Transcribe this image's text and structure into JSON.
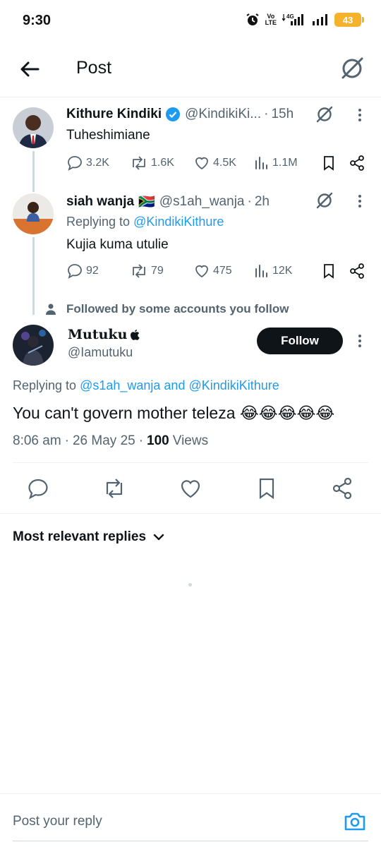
{
  "status_bar": {
    "time": "9:30",
    "battery": "43",
    "network": "4G",
    "volte_top": "Vo",
    "volte_bottom": "LTE"
  },
  "header": {
    "title": "Post"
  },
  "thread": [
    {
      "name": "Kithure Kindiki",
      "verified": true,
      "handle": "@KindikiKi...",
      "time": "15h",
      "text": "Tuheshimiane",
      "stats": {
        "replies": "3.2K",
        "reposts": "1.6K",
        "likes": "4.5K",
        "views": "1.1M"
      }
    },
    {
      "name": "siah wanja",
      "flag": "🇿🇦",
      "handle": "@s1ah_wanja",
      "time": "2h",
      "replying_prefix": "Replying to",
      "replying_to": "@KindikiKithure",
      "text": "Kujia kuma utulie",
      "stats": {
        "replies": "92",
        "reposts": "79",
        "likes": "475",
        "views": "12K"
      }
    }
  ],
  "social_context": "Followed by some accounts you follow",
  "main_post": {
    "name": "Mutuku",
    "name_suffix": "",
    "handle": "@Iamutuku",
    "follow_label": "Follow",
    "replying_prefix": "Replying to",
    "replying_to": "@s1ah_wanja and @KindikiKithure",
    "text": "You can't govern mother teleza 😂😂😂😂😂",
    "time": "8:06 am",
    "date": "26 May 25",
    "views_count": "100",
    "views_label": "Views"
  },
  "sort": {
    "label": "Most relevant replies"
  },
  "reply_bar": {
    "placeholder": "Post your reply"
  },
  "colors": {
    "accent": "#1d9bf0",
    "text": "#0f1419",
    "secondary": "#536471",
    "line": "#cfd9de",
    "battery": "#f4b32a"
  }
}
